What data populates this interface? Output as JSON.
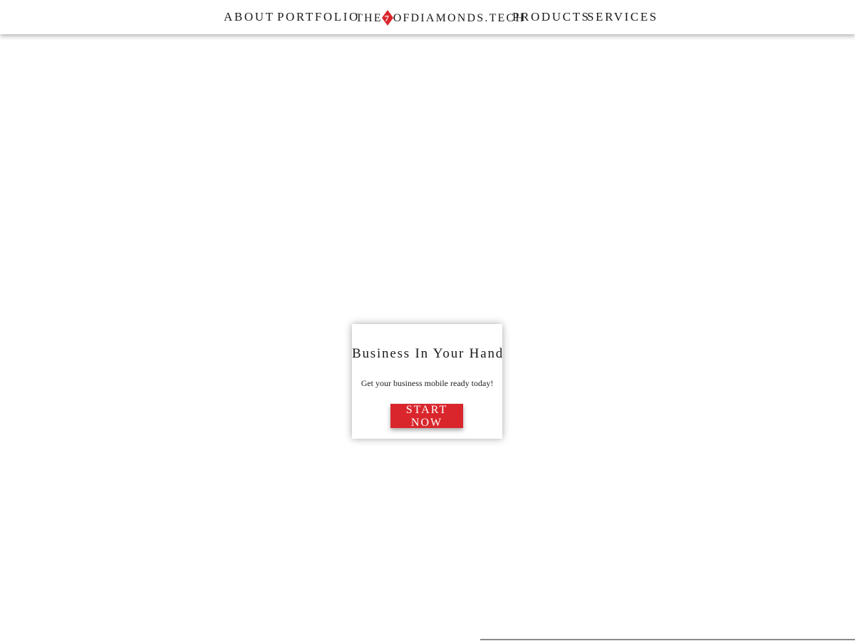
{
  "nav": {
    "about": "ABOUT",
    "portfolio": "PORTFOLIO",
    "brand_prefix": "THE",
    "brand_suffix": "OFDIAMONDS.TECH",
    "brand_logo_letter": "7",
    "products": "PRODUCTS",
    "services": "SERVICES"
  },
  "hero_card": {
    "title": "Business In Your Hand",
    "subtitle": "Get your business mobile ready today!",
    "cta_label": "START NOW"
  },
  "colors": {
    "accent": "#d9262c",
    "text": "#1a1a1a",
    "background": "#ffffff"
  },
  "icons": {
    "brand_logo": "red-diamond-seven-icon"
  }
}
